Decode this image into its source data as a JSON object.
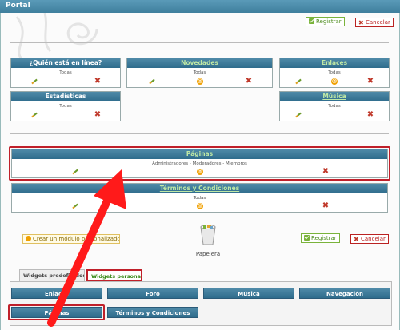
{
  "header": {
    "title": "Portal"
  },
  "top_actions": {
    "register_label": "Registrar",
    "cancel_label": "Cancelar"
  },
  "row1": [
    {
      "title": "¿Quién está en línea?",
      "linked": false,
      "visibility": "Todas"
    },
    {
      "title": "Novedades",
      "linked": true,
      "visibility": "Todas"
    },
    {
      "title": "Enlaces",
      "linked": true,
      "visibility": "Todas"
    }
  ],
  "row2": [
    {
      "title": "Estadísticas",
      "linked": false,
      "visibility": "Todas"
    },
    {
      "title": "Música",
      "linked": true,
      "visibility": "Todas"
    }
  ],
  "paginas_widget": {
    "title": "Páginas",
    "visibility": "Administradores - Moderadores - Miembros"
  },
  "terminos_widget": {
    "title": "Términos y Condiciones",
    "visibility": "Todas"
  },
  "bottom": {
    "custom_module_label": "Crear un módulo personalizado",
    "trash_label": "Papelera",
    "register_label": "Registrar",
    "cancel_label": "Cancelar"
  },
  "tabs": [
    {
      "label": "Widgets predefinidos",
      "active": false
    },
    {
      "label": "Widgets personales",
      "active": true
    }
  ],
  "widget_pills": [
    "Enlaces",
    "Foro",
    "Música",
    "Navegación",
    "Páginas",
    "Términos y Condiciones"
  ],
  "colors": {
    "header": "#3f7f9d",
    "highlight": "#c0202a",
    "arrow": "#ff1a1a"
  }
}
